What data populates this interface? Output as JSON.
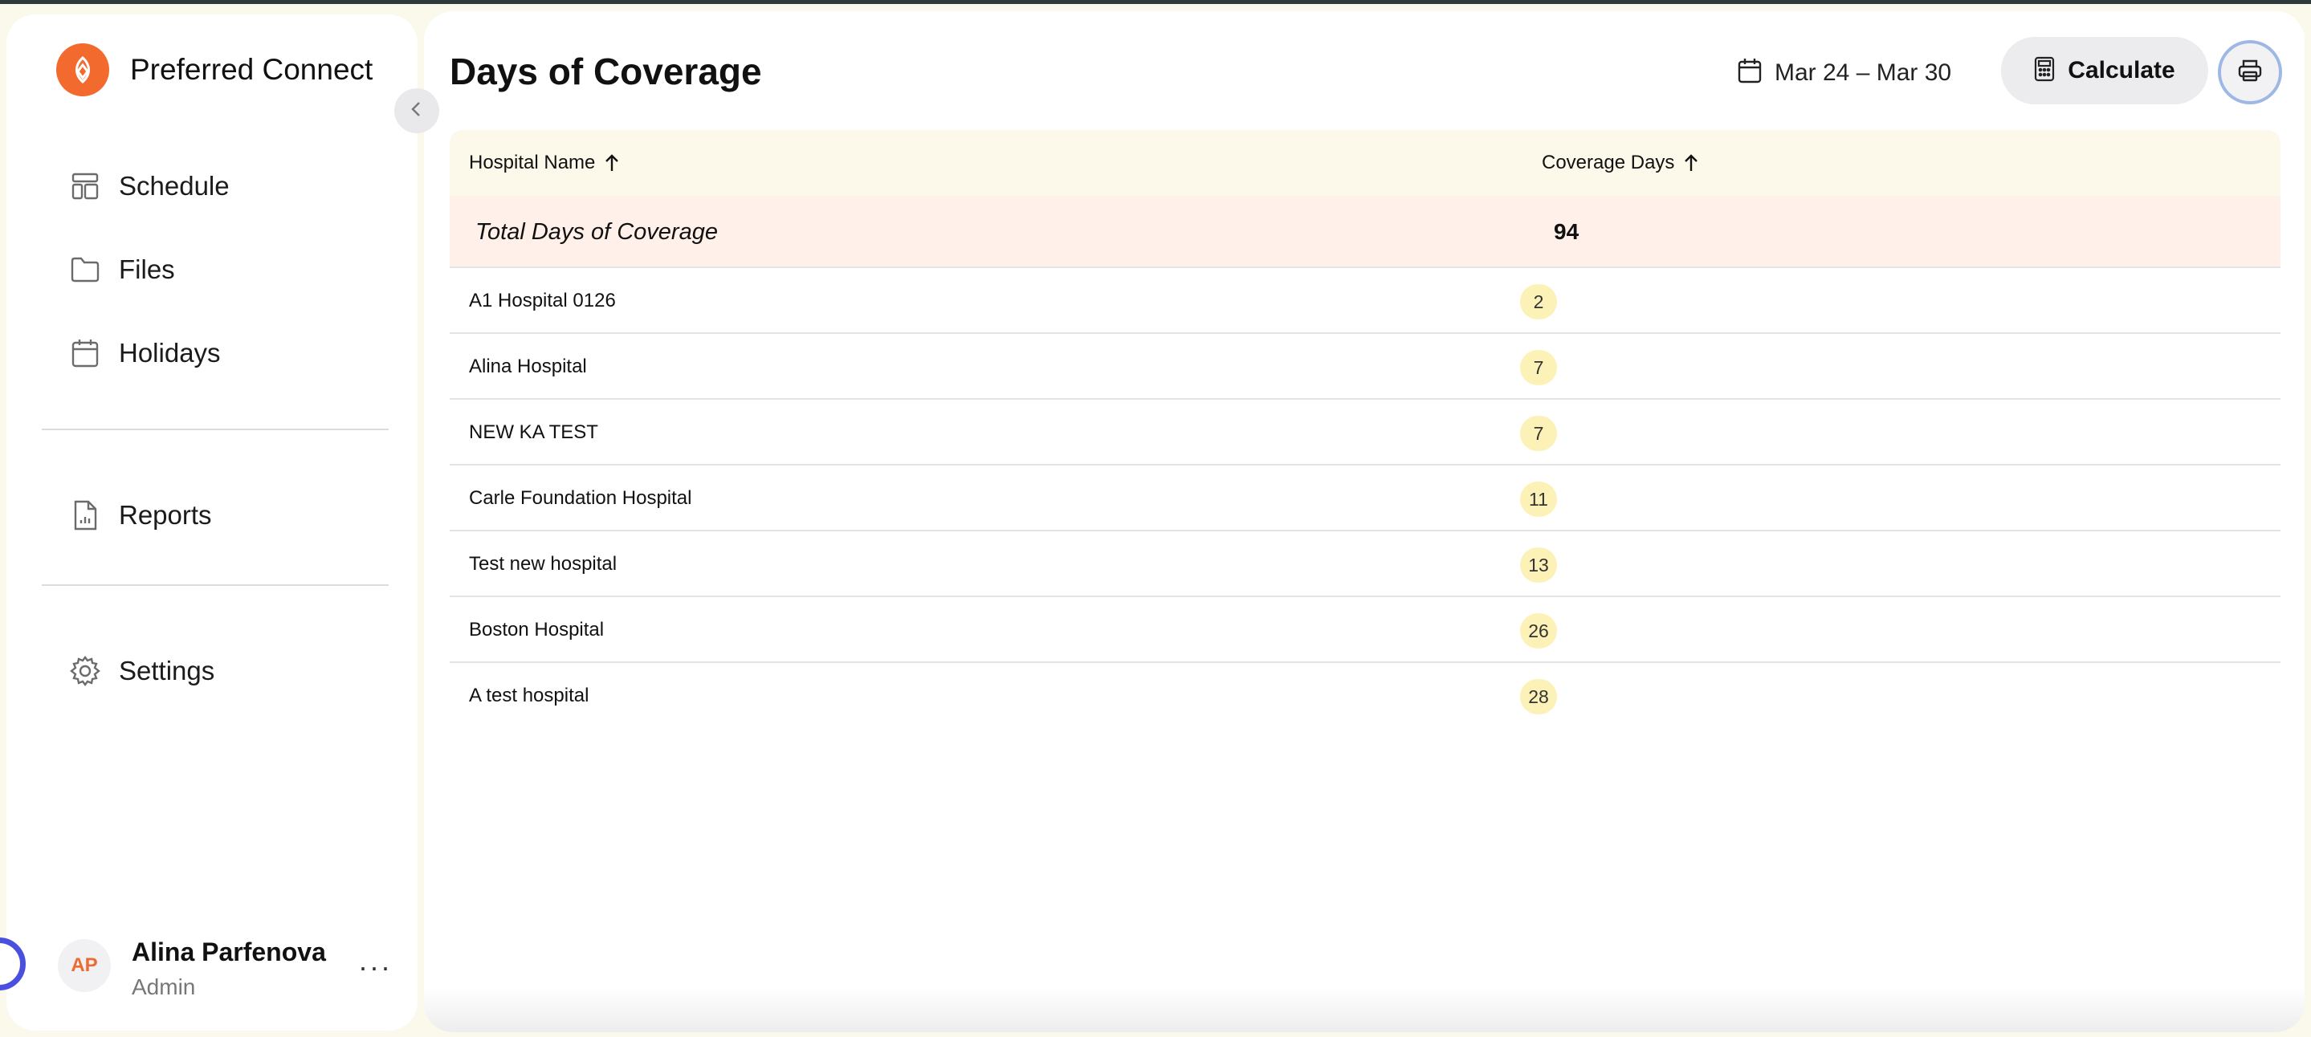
{
  "brand": {
    "name": "Preferred Connect"
  },
  "sidebar": {
    "items": [
      {
        "label": "Schedule",
        "icon": "layout-icon"
      },
      {
        "label": "Files",
        "icon": "folder-icon"
      },
      {
        "label": "Holidays",
        "icon": "calendar-icon"
      },
      {
        "label": "Reports",
        "icon": "report-file-icon"
      },
      {
        "label": "Settings",
        "icon": "gear-icon"
      }
    ]
  },
  "user": {
    "initials": "AP",
    "name": "Alina Parfenova",
    "role": "Admin",
    "more": "···"
  },
  "header": {
    "title": "Days of Coverage",
    "date_range": "Mar 24 – Mar 30",
    "calculate_label": "Calculate"
  },
  "table": {
    "columns": [
      "Hospital Name",
      "Coverage Days"
    ],
    "total": {
      "label": "Total Days of Coverage",
      "value": "94"
    },
    "rows": [
      {
        "name": "A1 Hospital 0126",
        "days": "2"
      },
      {
        "name": "Alina Hospital",
        "days": "7"
      },
      {
        "name": "NEW KA TEST",
        "days": "7"
      },
      {
        "name": "Carle Foundation Hospital",
        "days": "11"
      },
      {
        "name": "Test new hospital",
        "days": "13"
      },
      {
        "name": "Boston Hospital",
        "days": "26"
      },
      {
        "name": "A test hospital",
        "days": "28"
      }
    ]
  },
  "colors": {
    "accent": "#f26a2e",
    "header_bg": "#fcf8ea",
    "total_bg": "#fff0ea",
    "badge_bg": "#fcf2b8"
  }
}
